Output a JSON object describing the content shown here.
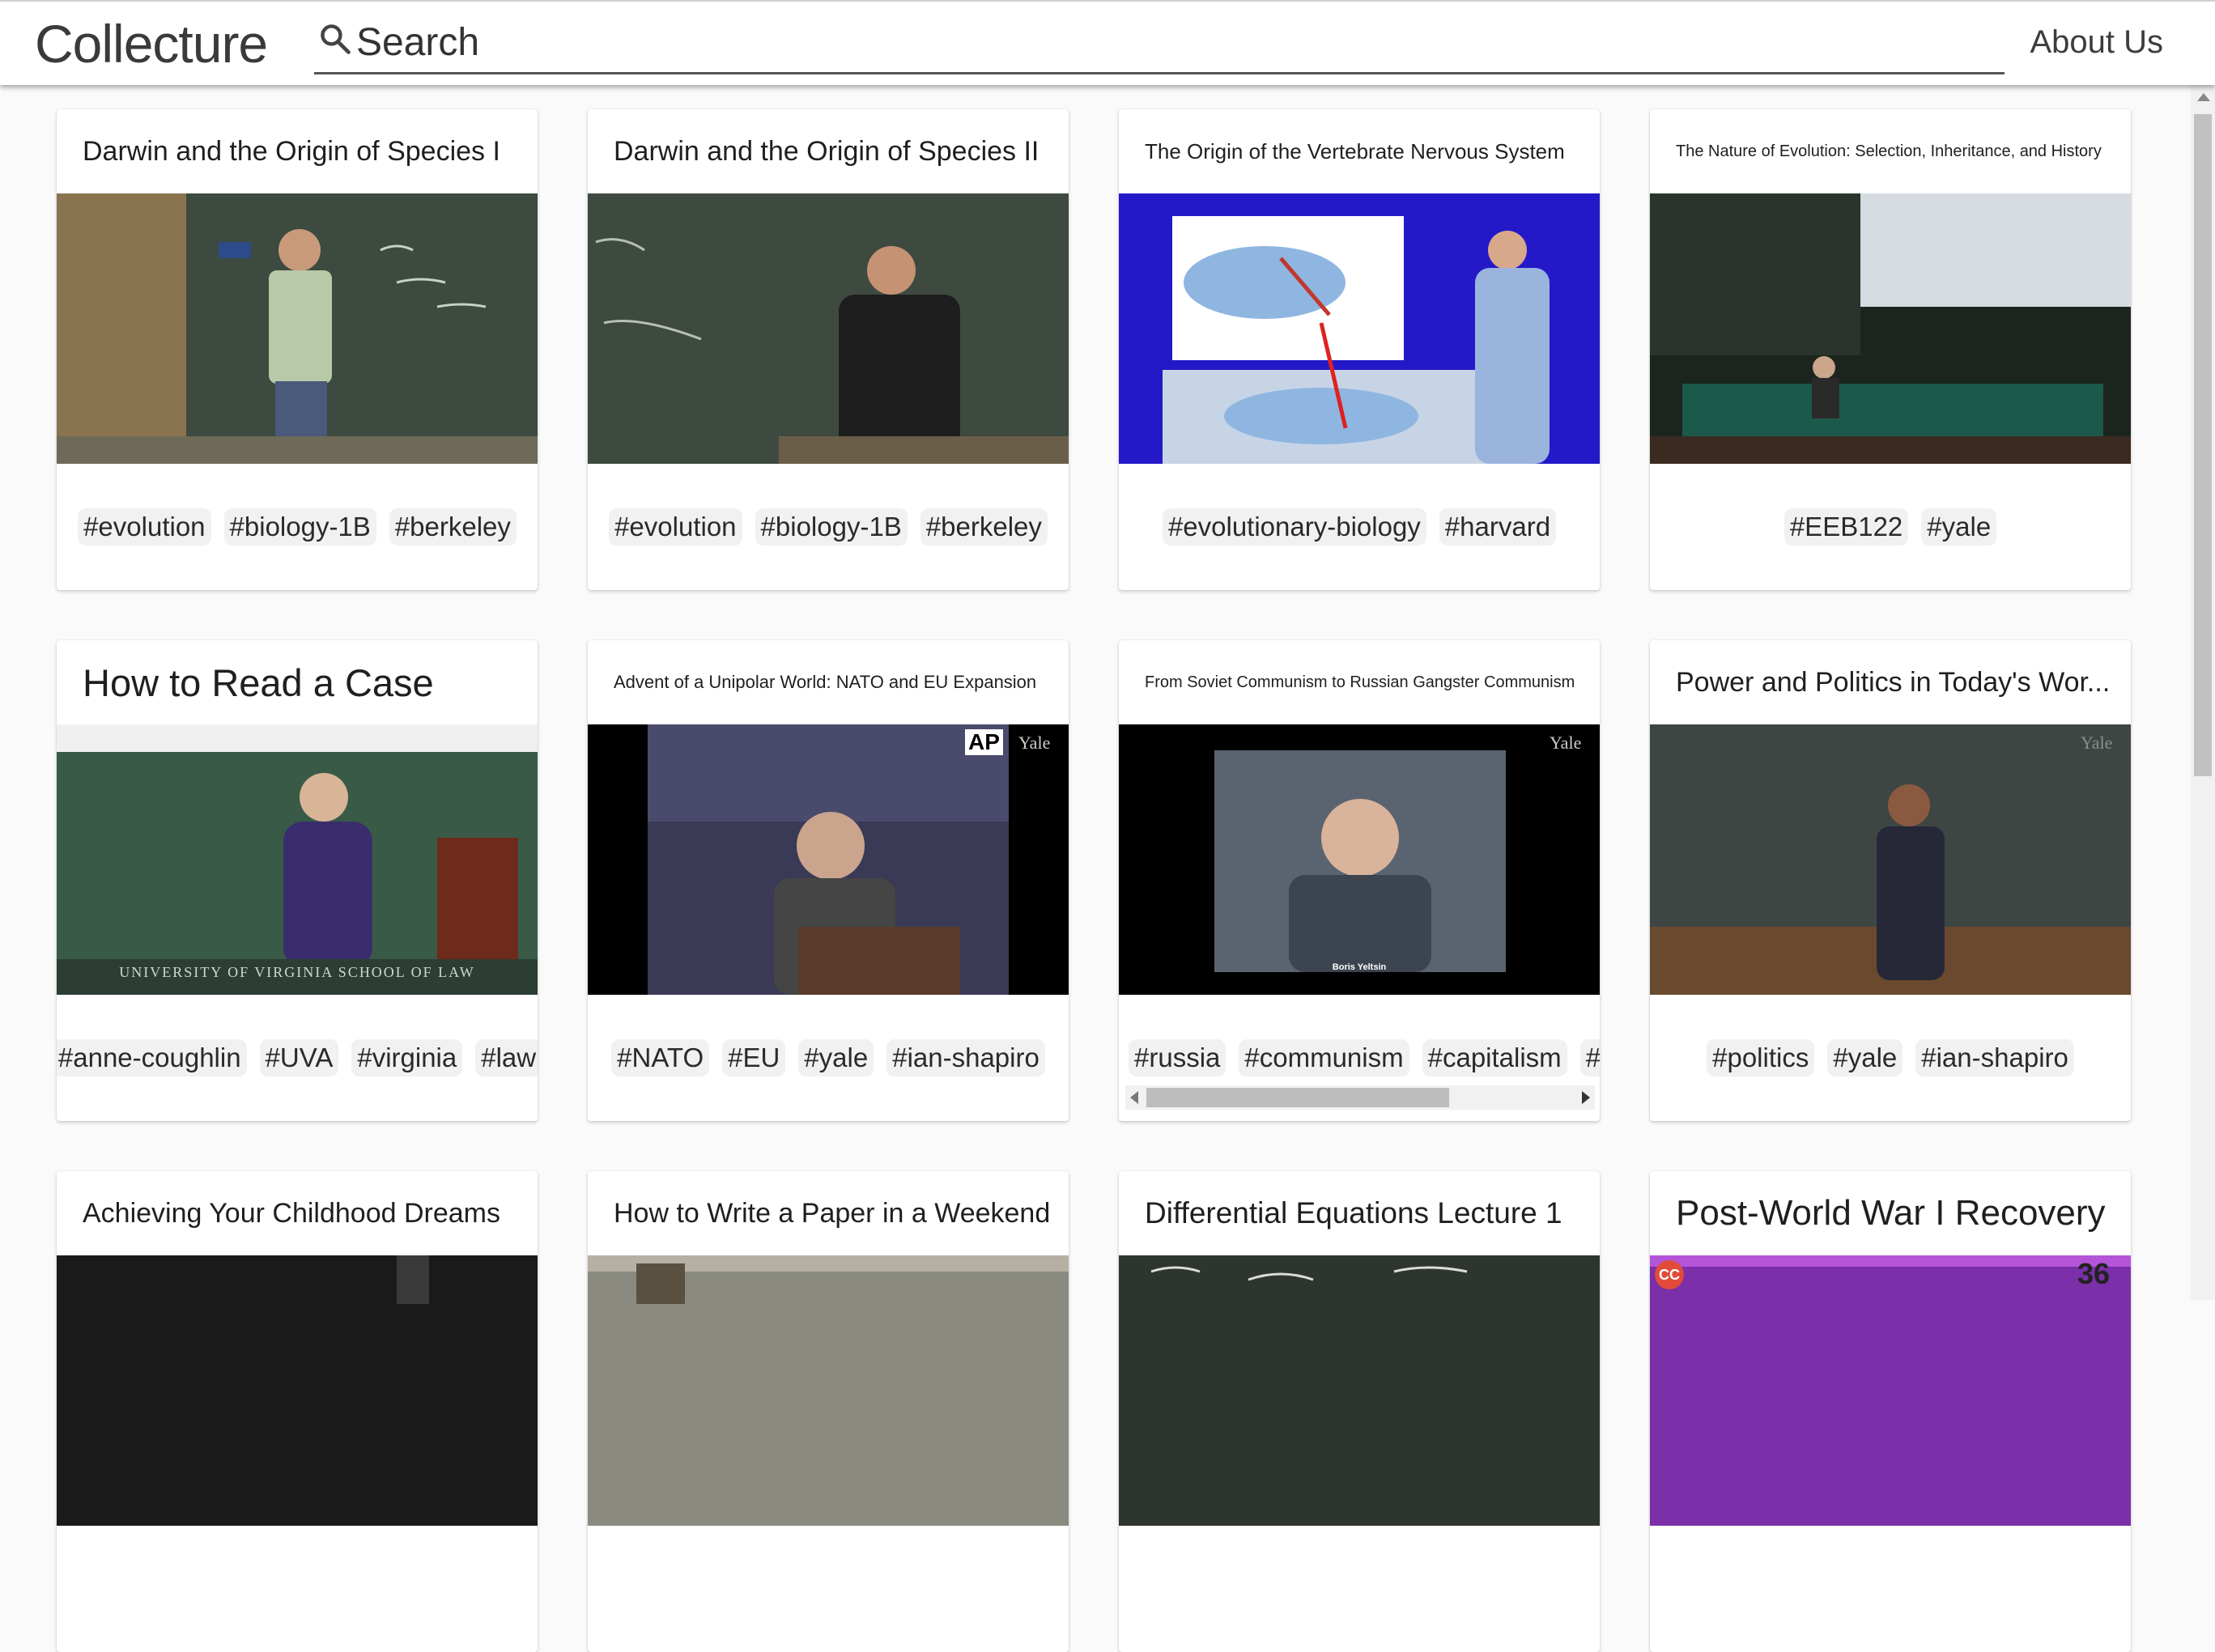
{
  "header": {
    "logo": "Collecture",
    "search_placeholder": "Search",
    "about_label": "About Us"
  },
  "cards": [
    {
      "title": "Darwin and the Origin of Species I",
      "tags": [
        "#evolution",
        "#biology-1B",
        "#berkeley"
      ]
    },
    {
      "title": "Darwin and the Origin of Species II",
      "tags": [
        "#evolution",
        "#biology-1B",
        "#berkeley"
      ]
    },
    {
      "title": "The Origin of the Vertebrate Nervous System",
      "tags": [
        "#evolutionary-biology",
        "#harvard"
      ]
    },
    {
      "title": "The Nature of Evolution: Selection, Inheritance, and History",
      "tags": [
        "#EEB122",
        "#yale"
      ]
    },
    {
      "title": "How to Read a Case",
      "tags": [
        "#anne-coughlin",
        "#UVA",
        "#virginia",
        "#law"
      ],
      "thumb_caption": "UNIVERSITY OF VIRGINIA SCHOOL OF LAW"
    },
    {
      "title": "Advent of a Unipolar World: NATO and EU Expansion",
      "tags": [
        "#NATO",
        "#EU",
        "#yale",
        "#ian-shapiro"
      ],
      "thumb_badges": [
        "AP",
        "Yale"
      ]
    },
    {
      "title": "From Soviet Communism to Russian Gangster Communism",
      "tags": [
        "#russia",
        "#communism",
        "#capitalism",
        "#ya"
      ],
      "thumb_badges": [
        "Yale"
      ],
      "thumb_caption": "Boris Yeltsin"
    },
    {
      "title": "Power and Politics in Today's Wor...",
      "tags": [
        "#politics",
        "#yale",
        "#ian-shapiro"
      ],
      "thumb_badges": [
        "Yale"
      ]
    },
    {
      "title": "Achieving Your Childhood Dreams",
      "tags": []
    },
    {
      "title": "How to Write a Paper in a Weekend",
      "tags": []
    },
    {
      "title": "Differential Equations Lecture 1",
      "tags": []
    },
    {
      "title": "Post-World War I Recovery",
      "tags": [],
      "thumb_badges": [
        "CC",
        "36"
      ]
    }
  ],
  "colors": {
    "header_bg": "#ffffff",
    "page_bg": "#fafafa",
    "tag_bg": "#f1f1f1",
    "text": "#222222"
  }
}
